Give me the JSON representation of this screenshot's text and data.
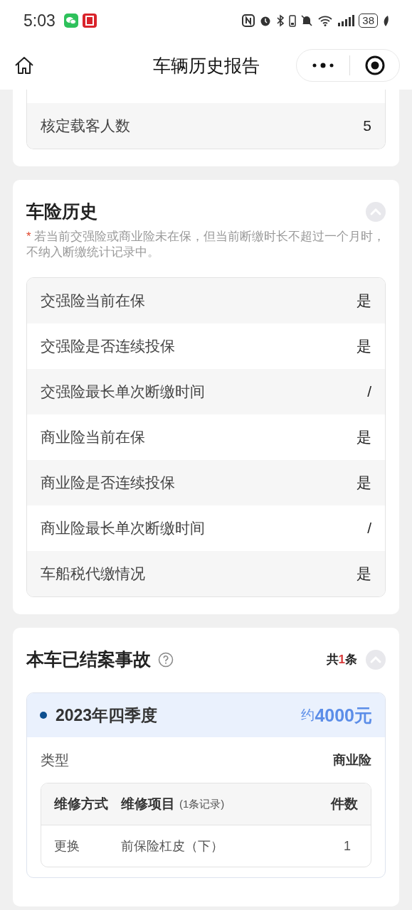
{
  "status_bar": {
    "time": "5:03",
    "battery": "38"
  },
  "nav": {
    "title": "车辆历史报告"
  },
  "basic_rows": [
    {
      "label": "核定载客人数",
      "value": "5"
    }
  ],
  "insurance": {
    "title": "车险历史",
    "expanded": true,
    "note_mark": "*",
    "note": "若当前交强险或商业险未在保，但当前断缴时长不超过一个月时，不纳入断缴统计记录中。",
    "rows": [
      {
        "label": "交强险当前在保",
        "value": "是"
      },
      {
        "label": "交强险是否连续投保",
        "value": "是"
      },
      {
        "label": "交强险最长单次断缴时间",
        "value": "/"
      },
      {
        "label": "商业险当前在保",
        "value": "是"
      },
      {
        "label": "商业险是否连续投保",
        "value": "是"
      },
      {
        "label": "商业险最长单次断缴时间",
        "value": "/"
      },
      {
        "label": "车船税代缴情况",
        "value": "是"
      }
    ]
  },
  "accidents": {
    "title": "本车已结案事故",
    "expanded": true,
    "count_prefix": "共",
    "count": "1",
    "count_suffix": "条",
    "items": [
      {
        "period": "2023年四季度",
        "amount_prefix": "约",
        "amount": "4000元",
        "type_label": "类型",
        "type_value": "商业险",
        "repair_table": {
          "columns": [
            "维修方式",
            "维修项目",
            "件数"
          ],
          "record_note": "(1条记录)",
          "rows": [
            {
              "method": "更换",
              "item": "前保险杠皮（下）",
              "count": "1"
            }
          ]
        }
      }
    ]
  }
}
